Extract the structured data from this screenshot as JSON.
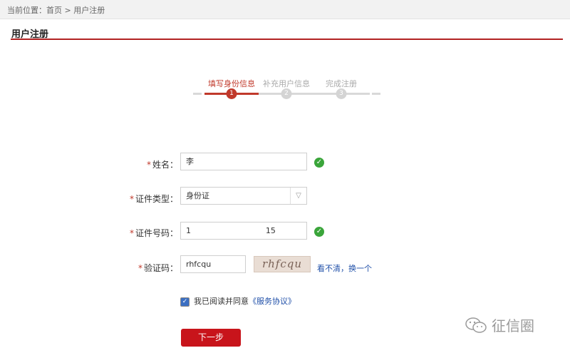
{
  "breadcrumb": {
    "prefix": "当前位置：",
    "home": "首页",
    "separator": " > ",
    "current": "用户注册"
  },
  "page_title": "用户注册",
  "steps": [
    {
      "label": "填写身份信息",
      "number": "1",
      "state": "active"
    },
    {
      "label": "补充用户信息",
      "number": "2",
      "state": "inactive"
    },
    {
      "label": "完成注册",
      "number": "3",
      "state": "inactive"
    }
  ],
  "form": {
    "required_mark": "*",
    "name": {
      "label": "姓名：",
      "value": "李"
    },
    "id_type": {
      "label": "证件类型：",
      "value": "身份证"
    },
    "id_number": {
      "label": "证件号码：",
      "value": "1                              15"
    },
    "captcha": {
      "label": "验证码：",
      "value": "rhfcqu",
      "image_text": "rhfcqu",
      "refresh": "看不清，换一个"
    }
  },
  "agreement": {
    "checked": true,
    "text": "我已阅读并同意",
    "link": "《服务协议》"
  },
  "next_button": "下一步",
  "watermark": "征信圈",
  "colors": {
    "accent": "#c0392b",
    "button": "#c8141b",
    "success": "#3aa53a",
    "link": "#1f4fa8"
  }
}
